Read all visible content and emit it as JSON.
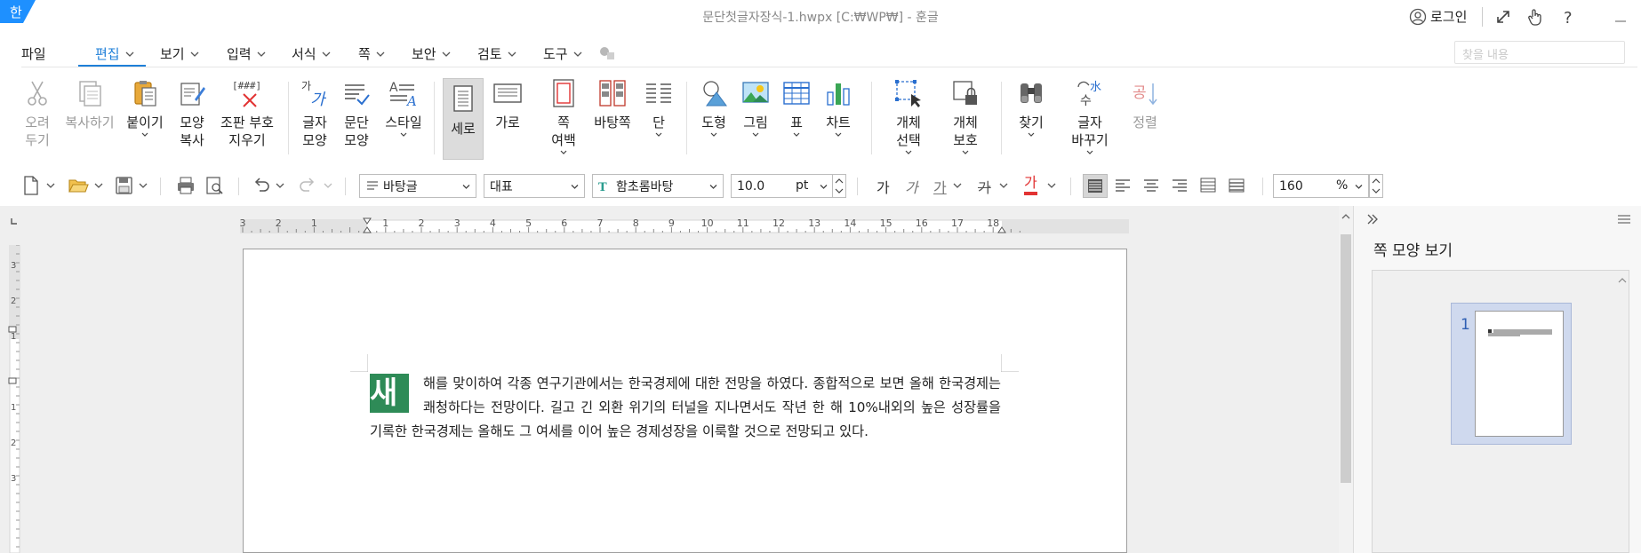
{
  "titlebar": {
    "app_logo_char": "한",
    "doc_title": "문단첫글자장식-1.hwpx [C:₩WP₩] - 훈글",
    "login_label": "로그인"
  },
  "menubar": {
    "file_label": "파일",
    "items": [
      "편집",
      "보기",
      "입력",
      "서식",
      "쪽",
      "보안",
      "검토",
      "도구"
    ],
    "active_item": "편집",
    "search_placeholder": "찾을 내용"
  },
  "ribbon": {
    "cut": [
      "오려",
      "두기"
    ],
    "copy": "복사하기",
    "paste": "붙이기",
    "format_copy": [
      "모양",
      "복사"
    ],
    "field_clear": [
      "조판 부호",
      "지우기"
    ],
    "field_icon_text": "[###]",
    "char_shape": [
      "글자",
      "모양"
    ],
    "para_shape": [
      "문단",
      "모양"
    ],
    "style": "스타일",
    "portrait": "세로",
    "landscape": "가로",
    "page_margin": [
      "쪽",
      "여백"
    ],
    "page_bg": "바탕쪽",
    "columns": "단",
    "shape": "도형",
    "picture": "그림",
    "table": "표",
    "chart": "차트",
    "obj_select": [
      "개체",
      "선택"
    ],
    "obj_protect": [
      "개체",
      "보호"
    ],
    "find": "찾기",
    "replace": [
      "글자",
      "바꾸기"
    ],
    "sort": "정렬",
    "char_icon_text": "가",
    "replace_icon_text": "水",
    "replace_icon_text2": "수",
    "sort_icon_text": "공"
  },
  "format_toolbar": {
    "style_name": "바탕글",
    "lang": "대표",
    "font_name": "함초롬바탕",
    "font_size": "10.0",
    "font_unit": "pt",
    "zoom": "160",
    "zoom_unit": "%",
    "bold_char": "가",
    "italic_char": "가",
    "underline_char": "가",
    "strike_char": "가",
    "color_char": "가"
  },
  "ruler": {
    "top_labels": [
      "3",
      "2",
      "1",
      "",
      "1",
      "2",
      "3",
      "4",
      "5",
      "6",
      "7",
      "8",
      "9",
      "10",
      "11",
      "12",
      "13",
      "14",
      "15",
      "16",
      "17",
      "18"
    ],
    "left_labels": [
      "3",
      "2",
      "1",
      "1",
      "2",
      "3"
    ]
  },
  "document": {
    "dropcap": "새",
    "text": "해를 맞이하여 각종 연구기관에서는 한국경제에 대한 전망을 하였다. 종합적으로 보면 올해 한국경제는 쾌청하다는 전망이다. 길고 긴 외환 위기의 터널을 지나면서도 작년 한 해 10%내외의 높은 성장률을 기록한 한국경제는 올해도 그 여세를 이어 높은 경제성장을 이룩할 것으로 전망되고 있다.",
    "dropcap_color": "#2e8b57"
  },
  "right_panel": {
    "title": "쪽 모양 보기",
    "page_number": "1"
  },
  "colors": {
    "accent": "#1e7fd8",
    "logo_bg": "#1e90ff"
  }
}
